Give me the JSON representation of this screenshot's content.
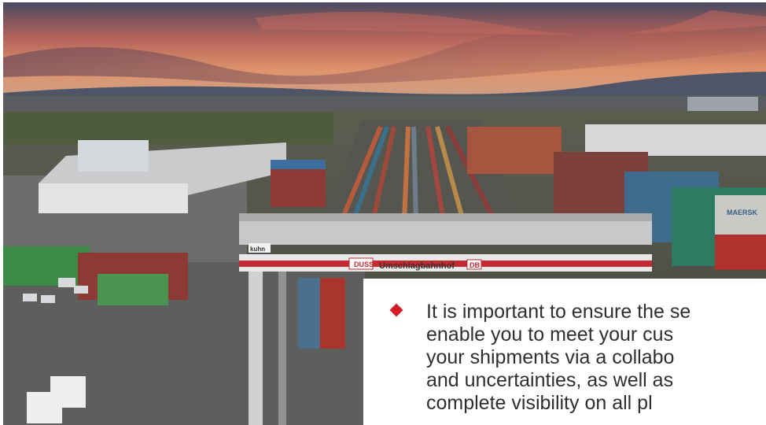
{
  "photo": {
    "subject": "intermodal container terminal",
    "sign_text": "Umschlagbahnhof",
    "sign_left_badge": "DUSS",
    "sign_right_badge": "DB",
    "crane_brand": "kuhn",
    "container_labels": [
      "MAERSK"
    ]
  },
  "bullet": {
    "icon": "red-diamond-bullet",
    "accent_color": "#d51c2a",
    "lines": [
      "It is important to ensure the se",
      "enable you to meet your cus",
      "your shipments via a collabo",
      "and uncertainties, as well as",
      "complete visibility on all pl"
    ]
  }
}
